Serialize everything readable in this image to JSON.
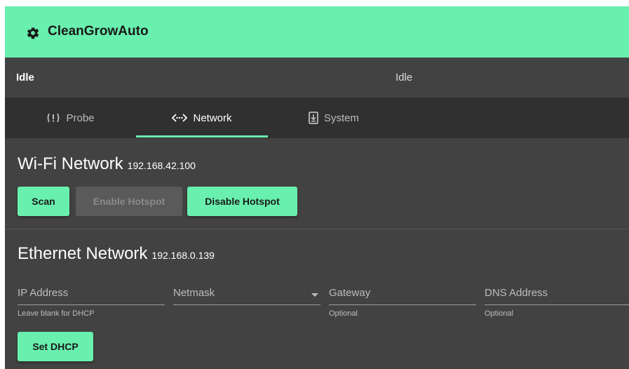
{
  "app": {
    "title": "CleanGrowAuto"
  },
  "status": {
    "left": "Idle",
    "center": "Idle"
  },
  "tabs": [
    {
      "label": "Probe",
      "icon": "probe-alert-icon"
    },
    {
      "label": "Network",
      "icon": "network-arrows-icon"
    },
    {
      "label": "System",
      "icon": "system-download-icon"
    }
  ],
  "wifi": {
    "title": "Wi-Fi Network",
    "ip": "192.168.42.100",
    "scan_label": "Scan",
    "enable_hotspot_label": "Enable Hotspot",
    "disable_hotspot_label": "Disable Hotspot"
  },
  "ethernet": {
    "title": "Ethernet Network",
    "ip": "192.168.0.139",
    "fields": [
      {
        "label": "IP Address",
        "hint": "Leave blank for DHCP"
      },
      {
        "label": "Netmask",
        "hint": ""
      },
      {
        "label": "Gateway",
        "hint": "Optional"
      },
      {
        "label": "DNS Address",
        "hint": "Optional"
      }
    ],
    "set_dhcp_label": "Set DHCP"
  },
  "colors": {
    "accent": "#69f0ae",
    "background": "#424242",
    "tabbar": "#303030"
  }
}
